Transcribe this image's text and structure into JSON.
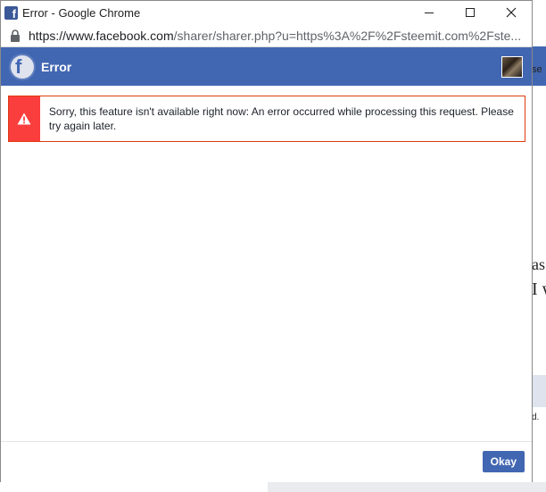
{
  "window": {
    "title": "Error - Google Chrome",
    "url_host": "https://www.facebook.com",
    "url_path": "/sharer/sharer.php?u=https%3A%2F%2Fsteemit.com%2Fste..."
  },
  "header": {
    "title": "Error"
  },
  "error": {
    "message": "Sorry, this feature isn't available right now: An error occurred while processing this request. Please try again later."
  },
  "footer": {
    "okay_label": "Okay"
  },
  "background_page": {
    "fragment_1": "se",
    "fragment_2": "as",
    "fragment_3": "I w",
    "fragment_4": "d."
  },
  "colors": {
    "facebook_blue": "#4267b2",
    "error_red": "#fa3e3e"
  }
}
